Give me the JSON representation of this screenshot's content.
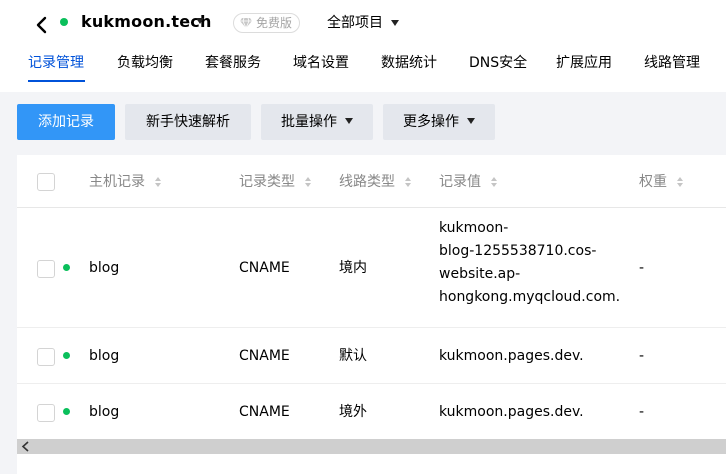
{
  "header": {
    "domain": "kukmoon.tech",
    "plan_badge": "免费版",
    "project_select": "全部项目"
  },
  "tabs": [
    {
      "label": "记录管理",
      "active": true
    },
    {
      "label": "负载均衡"
    },
    {
      "label": "套餐服务"
    },
    {
      "label": "域名设置"
    },
    {
      "label": "数据统计"
    },
    {
      "label": "DNS安全"
    },
    {
      "label": "扩展应用"
    },
    {
      "label": "线路管理"
    }
  ],
  "toolbar": {
    "add_record": "添加记录",
    "quick_resolve": "新手快速解析",
    "batch_ops": "批量操作",
    "more_ops": "更多操作"
  },
  "table": {
    "columns": {
      "host": "主机记录",
      "type": "记录类型",
      "line": "线路类型",
      "value": "记录值",
      "weight": "权重"
    },
    "rows": [
      {
        "host": "blog",
        "type": "CNAME",
        "line": "境内",
        "value_lines": [
          "kukmoon-",
          "blog-1255538710.cos-",
          "website.ap-",
          "hongkong.myqcloud.com."
        ],
        "weight": "-"
      },
      {
        "host": "blog",
        "type": "CNAME",
        "line": "默认",
        "value_lines": [
          "kukmoon.pages.dev."
        ],
        "weight": "-"
      },
      {
        "host": "blog",
        "type": "CNAME",
        "line": "境外",
        "value_lines": [
          "kukmoon.pages.dev."
        ],
        "weight": "-"
      }
    ]
  },
  "colors": {
    "primary_button": "#3296f7",
    "active_tab": "#0052d9",
    "status_dot": "#0abf5b",
    "page_background": "#f3f4f7"
  }
}
